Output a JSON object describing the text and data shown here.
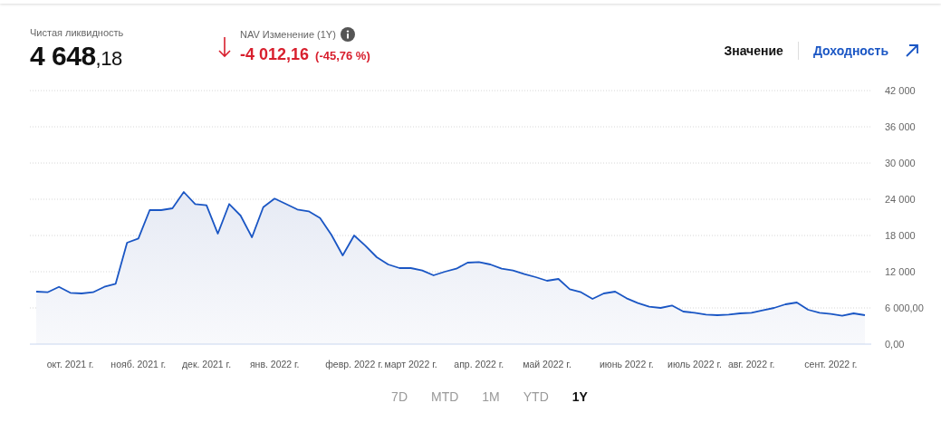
{
  "summary": {
    "label": "Чистая ликвидность",
    "value_main": "4 648",
    "value_decimal": ",18"
  },
  "nav_change": {
    "label": "NAV Изменение (1Y)",
    "negative": true,
    "change": "-4 012,16",
    "percent": "(-45,76 %)"
  },
  "views": [
    {
      "label": "Значение",
      "selected": true
    },
    {
      "label": "Доходность",
      "selected": false
    }
  ],
  "chart": {
    "chart_data": {
      "type": "area",
      "grid": true,
      "ylim": [
        0,
        42000
      ],
      "yticks": [
        {
          "value": 0,
          "label": "0,00"
        },
        {
          "value": 6000,
          "label": "6 000,00"
        },
        {
          "value": 12000,
          "label": "12 000"
        },
        {
          "value": 18000,
          "label": "18 000"
        },
        {
          "value": 24000,
          "label": "24 000"
        },
        {
          "value": 30000,
          "label": "30 000"
        },
        {
          "value": 36000,
          "label": "36 000"
        },
        {
          "value": 42000,
          "label": "42 000"
        }
      ],
      "categories": [
        null,
        null,
        null,
        "окт. 2021 г.",
        null,
        null,
        null,
        null,
        null,
        "нояб. 2021 г.",
        null,
        null,
        null,
        null,
        null,
        "дек. 2021 г.",
        null,
        null,
        null,
        null,
        null,
        "янв. 2022 г.",
        null,
        null,
        null,
        null,
        null,
        null,
        "февр. 2022 г.",
        null,
        null,
        null,
        null,
        "март 2022 г.",
        null,
        null,
        null,
        null,
        null,
        "апр. 2022 г.",
        null,
        null,
        null,
        null,
        null,
        "май 2022 г.",
        null,
        null,
        null,
        null,
        null,
        null,
        "июнь 2022 г.",
        null,
        null,
        null,
        null,
        null,
        "июль 2022 г.",
        null,
        null,
        null,
        null,
        "авг. 2022 г.",
        null,
        null,
        null,
        null,
        null,
        null,
        "сент. 2022 г.",
        null,
        null,
        null
      ],
      "series": [
        {
          "color": "#1a56c4",
          "values": [
            8700,
            8600,
            9500,
            8500,
            8400,
            8600,
            9500,
            10000,
            16800,
            17500,
            22200,
            22200,
            22500,
            25200,
            23200,
            23000,
            18300,
            23200,
            21300,
            17700,
            22700,
            24100,
            23200,
            22300,
            22000,
            20900,
            18100,
            14700,
            18000,
            16300,
            14400,
            13200,
            12600,
            12600,
            12200,
            11400,
            12000,
            12500,
            13500,
            13600,
            13200,
            12500,
            12200,
            11600,
            11100,
            10500,
            10800,
            9100,
            8600,
            7500,
            8400,
            8700,
            7600,
            6800,
            6200,
            6000,
            6400,
            5400,
            5200,
            4900,
            4800,
            4900,
            5100,
            5200,
            5600,
            6000,
            6600,
            6900,
            5700,
            5200,
            5000,
            4700,
            5100,
            4800
          ]
        }
      ]
    }
  },
  "periods": [
    {
      "label": "7D",
      "selected": false
    },
    {
      "label": "MTD",
      "selected": false
    },
    {
      "label": "1M",
      "selected": false
    },
    {
      "label": "YTD",
      "selected": false
    },
    {
      "label": "1Y",
      "selected": true
    }
  ]
}
